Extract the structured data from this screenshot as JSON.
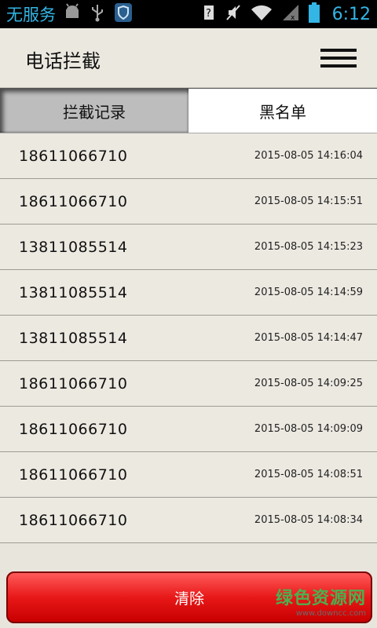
{
  "statusbar": {
    "carrier": "无服务",
    "time": "6:12",
    "icons_left": [
      "android-debug-icon",
      "usb-icon",
      "shield-app-icon"
    ],
    "icons_right": [
      "signal-unknown-icon",
      "mute-icon",
      "wifi-icon",
      "cellular-icon",
      "battery-icon"
    ]
  },
  "header": {
    "title": "电话拦截"
  },
  "tabs": [
    {
      "label": "拦截记录",
      "active": true
    },
    {
      "label": "黑名单",
      "active": false
    }
  ],
  "records": [
    {
      "number": "18611066710",
      "time": "2015-08-05 14:16:04"
    },
    {
      "number": "18611066710",
      "time": "2015-08-05 14:15:51"
    },
    {
      "number": "13811085514",
      "time": "2015-08-05 14:15:23"
    },
    {
      "number": "13811085514",
      "time": "2015-08-05 14:14:59"
    },
    {
      "number": "13811085514",
      "time": "2015-08-05 14:14:47"
    },
    {
      "number": "18611066710",
      "time": "2015-08-05 14:09:25"
    },
    {
      "number": "18611066710",
      "time": "2015-08-05 14:09:09"
    },
    {
      "number": "18611066710",
      "time": "2015-08-05 14:08:51"
    },
    {
      "number": "18611066710",
      "time": "2015-08-05 14:08:34"
    }
  ],
  "actions": {
    "clear_label": "清除"
  },
  "watermark": {
    "main": "绿色资源网",
    "sub": "www.downcc.com"
  },
  "colors": {
    "status_accent": "#33b5e5",
    "clear_button": "#e81818",
    "watermark": "#4caf50"
  }
}
